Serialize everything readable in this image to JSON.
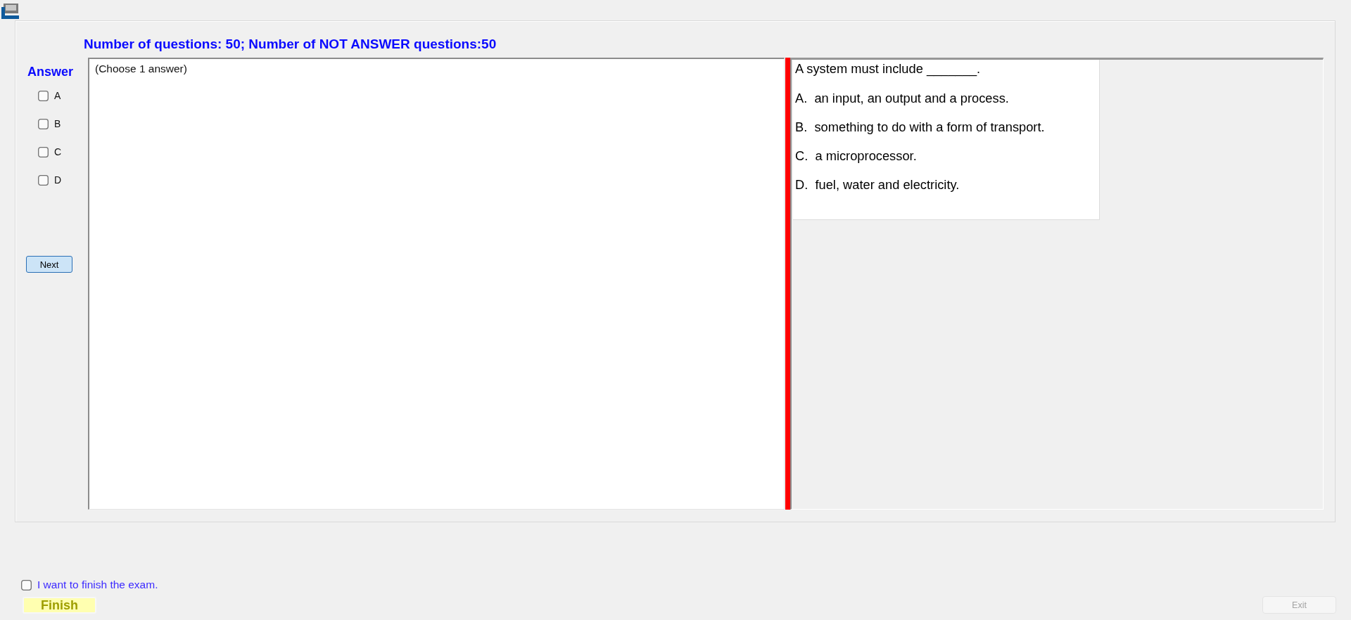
{
  "header": {
    "count_text": "Number of questions: 50; Number of NOT ANSWER questions:50"
  },
  "answer_panel": {
    "title": "Answer",
    "options": [
      {
        "label": "A",
        "checked": false
      },
      {
        "label": "B",
        "checked": false
      },
      {
        "label": "C",
        "checked": false
      },
      {
        "label": "D",
        "checked": false
      }
    ],
    "next_button": {
      "label": "Next"
    }
  },
  "answer_area": {
    "instruction": "(Choose 1 answer)"
  },
  "question": {
    "text": "A system must include _______.",
    "options": [
      "A.  an input, an output and a process.",
      "B.  something to do with a form of transport.",
      "C.  a microprocessor.",
      "D.  fuel, water and electricity."
    ]
  },
  "footer": {
    "finish_confirm": {
      "label": "I want to finish the exam.",
      "checked": false
    },
    "buttons": [
      {
        "kind": "finish",
        "label": "Finish",
        "disabled": false
      },
      {
        "kind": "exit",
        "label": "Exit",
        "disabled": true
      }
    ]
  }
}
